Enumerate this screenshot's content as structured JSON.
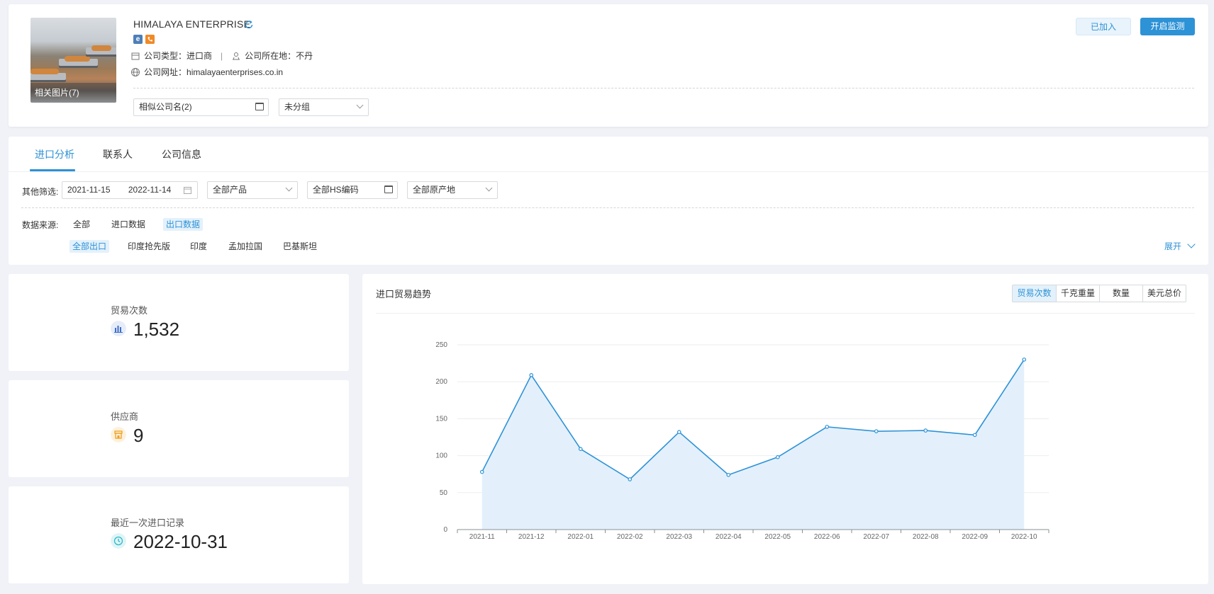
{
  "company": {
    "name": "HIMALAYA ENTERPRISE",
    "photo_caption": "相关图片(7)",
    "badge_ie": "e",
    "type_label": "公司类型：",
    "type_value": "进口商",
    "location_label": "公司所在地：",
    "location_value": "不丹",
    "website_label": "公司网址：",
    "website_value": "himalayaenterprises.co.in",
    "similar_select": "相似公司名(2)",
    "group_select": "未分组",
    "joined_button": "已加入",
    "monitor_button": "开启监测"
  },
  "tabs": [
    {
      "label": "进口分析",
      "active": true
    },
    {
      "label": "联系人",
      "active": false
    },
    {
      "label": "公司信息",
      "active": false
    }
  ],
  "filters": {
    "other_label": "其他筛选:",
    "date_start": "2021-11-15",
    "date_end": "2022-11-14",
    "product": "全部产品",
    "hs_code": "全部HS编码",
    "origin": "全部原产地",
    "source_label": "数据来源:",
    "sources": [
      "全部",
      "进口数据",
      "出口数据"
    ],
    "sub_sources": [
      "全部出口",
      "印度抢先版",
      "印度",
      "孟加拉国",
      "巴基斯坦"
    ],
    "expand": "展开"
  },
  "stats": [
    {
      "label": "贸易次数",
      "value": "1,532",
      "icon": "bar-chart-icon",
      "color": "#3d6fc9"
    },
    {
      "label": "供应商",
      "value": "9",
      "icon": "store-icon",
      "color": "#f0a020"
    },
    {
      "label": "最近一次进口记录",
      "value": "2022-10-31",
      "icon": "clock-icon",
      "color": "#2bb8c9"
    }
  ],
  "chart": {
    "title": "进口贸易趋势",
    "metrics": [
      {
        "label": "贸易次数",
        "active": true
      },
      {
        "label": "千克重量",
        "active": false
      },
      {
        "label": "数量",
        "active": false
      },
      {
        "label": "美元总价",
        "active": false
      }
    ]
  },
  "chart_data": {
    "type": "area",
    "categories": [
      "2021-11",
      "2021-12",
      "2022-01",
      "2022-02",
      "2022-03",
      "2022-04",
      "2022-05",
      "2022-06",
      "2022-07",
      "2022-08",
      "2022-09",
      "2022-10"
    ],
    "values": [
      78,
      209,
      109,
      68,
      132,
      74,
      98,
      139,
      133,
      134,
      128,
      230
    ],
    "ylim": [
      0,
      250
    ],
    "yticks": [
      0,
      50,
      100,
      150,
      200,
      250
    ],
    "grid": true,
    "line_color": "#2d92d6",
    "fill_color": "#e3f0fc"
  }
}
